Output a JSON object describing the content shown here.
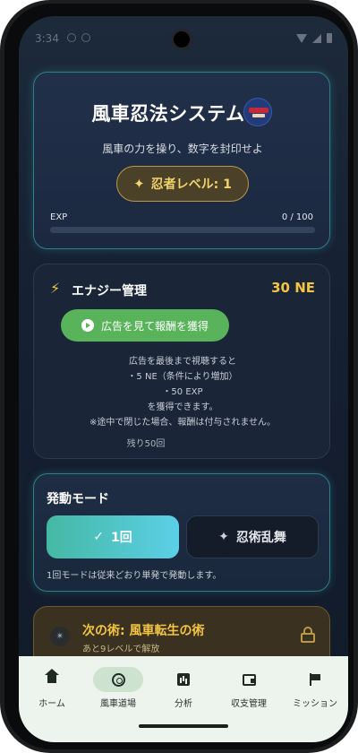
{
  "status": {
    "time": "3:34"
  },
  "header": {
    "title": "風車忍法システム",
    "subtitle": "風車の力を操り、数字を封印せよ",
    "level_label": "忍者レベル: 1",
    "exp_label": "EXP",
    "exp_value": "0 / 100",
    "exp_progress": 0
  },
  "energy": {
    "title": "エナジー管理",
    "value": "30 NE",
    "ad_button_label": "広告を見て報酬を獲得",
    "notice_lines": [
      "広告を最後まで視聴すると",
      "・5 NE（条件により増加）",
      "・50 EXP",
      "を獲得できます。",
      "※途中で閉じた場合、報酬は付与されません。"
    ],
    "remaining": "残り50回"
  },
  "mode": {
    "title": "発動モード",
    "once_label": "1回",
    "multi_label": "忍術乱舞",
    "note": "1回モードは従来どおり単発で発動します。"
  },
  "next_skill": {
    "title": "次の術: 風車転生の術",
    "subtitle": "あと9レベルで解放"
  },
  "nav": {
    "items": [
      {
        "label": "ホーム",
        "icon": "home-icon"
      },
      {
        "label": "風車道場",
        "icon": "pinwheel-icon"
      },
      {
        "label": "分析",
        "icon": "chart-icon"
      },
      {
        "label": "収支管理",
        "icon": "wallet-icon"
      },
      {
        "label": "ミッション",
        "icon": "flag-icon"
      }
    ],
    "active_index": 1
  },
  "colors": {
    "accent_gold": "#f3c542",
    "accent_teal": "#4fc3c8",
    "ad_green": "#58b35a",
    "nav_bg": "#edf3ed"
  }
}
